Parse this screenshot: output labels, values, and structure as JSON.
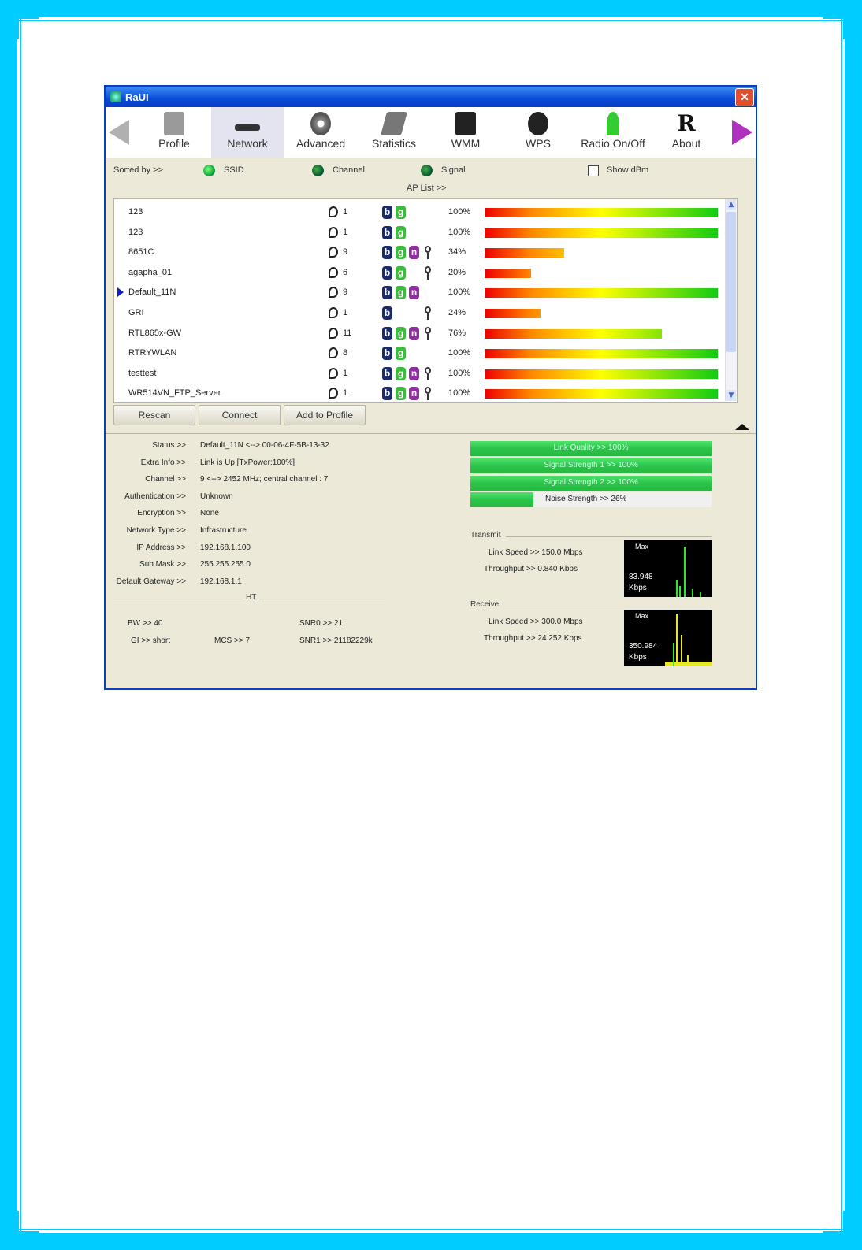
{
  "window": {
    "title": "RaUI"
  },
  "toolbar": {
    "items": [
      {
        "label": "Profile"
      },
      {
        "label": "Network"
      },
      {
        "label": "Advanced"
      },
      {
        "label": "Statistics"
      },
      {
        "label": "WMM"
      },
      {
        "label": "WPS"
      },
      {
        "label": "Radio On/Off"
      },
      {
        "label": "About"
      }
    ],
    "active": "Network"
  },
  "sort": {
    "sorted_by": "Sorted by >>",
    "ssid": "SSID",
    "channel": "Channel",
    "signal": "Signal",
    "show_dbm": "Show dBm",
    "ap_list": "AP List >>"
  },
  "ap_list": [
    {
      "ssid": "123",
      "channel": "1",
      "modes": [
        "b",
        "g"
      ],
      "lock": false,
      "signal_pct": "100%",
      "signal": 100,
      "selected": false
    },
    {
      "ssid": "123",
      "channel": "1",
      "modes": [
        "b",
        "g"
      ],
      "lock": false,
      "signal_pct": "100%",
      "signal": 100,
      "selected": false
    },
    {
      "ssid": "8651C",
      "channel": "9",
      "modes": [
        "b",
        "g",
        "n"
      ],
      "lock": true,
      "signal_pct": "34%",
      "signal": 34,
      "selected": false
    },
    {
      "ssid": "agapha_01",
      "channel": "6",
      "modes": [
        "b",
        "g"
      ],
      "lock": true,
      "signal_pct": "20%",
      "signal": 20,
      "selected": false
    },
    {
      "ssid": "Default_11N",
      "channel": "9",
      "modes": [
        "b",
        "g",
        "n"
      ],
      "lock": false,
      "signal_pct": "100%",
      "signal": 100,
      "selected": true
    },
    {
      "ssid": "GRI",
      "channel": "1",
      "modes": [
        "b"
      ],
      "lock": true,
      "signal_pct": "24%",
      "signal": 24,
      "selected": false
    },
    {
      "ssid": "RTL865x-GW",
      "channel": "11",
      "modes": [
        "b",
        "g",
        "n"
      ],
      "lock": true,
      "signal_pct": "76%",
      "signal": 76,
      "selected": false
    },
    {
      "ssid": "RTRYWLAN",
      "channel": "8",
      "modes": [
        "b",
        "g"
      ],
      "lock": false,
      "signal_pct": "100%",
      "signal": 100,
      "selected": false
    },
    {
      "ssid": "testtest",
      "channel": "1",
      "modes": [
        "b",
        "g",
        "n"
      ],
      "lock": true,
      "signal_pct": "100%",
      "signal": 100,
      "selected": false
    },
    {
      "ssid": "WR514VN_FTP_Server",
      "channel": "1",
      "modes": [
        "b",
        "g",
        "n"
      ],
      "lock": true,
      "signal_pct": "100%",
      "signal": 100,
      "selected": false
    }
  ],
  "buttons": {
    "rescan": "Rescan",
    "connect": "Connect",
    "add_profile": "Add to Profile"
  },
  "status": [
    {
      "key": "Status >>",
      "value": "Default_11N <--> 00-06-4F-5B-13-32"
    },
    {
      "key": "Extra Info >>",
      "value": "Link is Up [TxPower:100%]"
    },
    {
      "key": "Channel >>",
      "value": "9 <--> 2452 MHz; central channel : 7"
    },
    {
      "key": "Authentication >>",
      "value": "Unknown"
    },
    {
      "key": "Encryption >>",
      "value": "None"
    },
    {
      "key": "Network Type >>",
      "value": "Infrastructure"
    },
    {
      "key": "IP Address >>",
      "value": "192.168.1.100"
    },
    {
      "key": "Sub Mask >>",
      "value": "255.255.255.0"
    },
    {
      "key": "Default Gateway >>",
      "value": "192.168.1.1"
    }
  ],
  "ht": {
    "label": "HT",
    "bw": "BW >> 40",
    "gi": "GI >> short",
    "mcs": "MCS >> 7",
    "snr0": "SNR0 >> 21",
    "snr1": "SNR1 >> 21182229k"
  },
  "meters": [
    {
      "label": "Link Quality >> 100%",
      "value": 100
    },
    {
      "label": "Signal Strength 1 >> 100%",
      "value": 100
    },
    {
      "label": "Signal Strength 2 >> 100%",
      "value": 100
    },
    {
      "label": "Noise Strength >> 26%",
      "value": 26
    }
  ],
  "transmit": {
    "label": "Transmit",
    "link_speed": "Link Speed >> 150.0 Mbps",
    "throughput": "Throughput >> 0.840 Kbps",
    "graph_max": "Max",
    "graph_value": "83.948",
    "graph_unit": "Kbps"
  },
  "receive": {
    "label": "Receive",
    "link_speed": "Link Speed >> 300.0 Mbps",
    "throughput": "Throughput >> 24.252 Kbps",
    "graph_max": "Max",
    "graph_value": "350.984",
    "graph_unit": "Kbps"
  },
  "colors": {
    "frame": "#00ccff",
    "titlebar": "#0a3cc4",
    "badge_b": "#1a2a6a",
    "badge_g": "#3cbc3c",
    "badge_n": "#9030a0"
  }
}
